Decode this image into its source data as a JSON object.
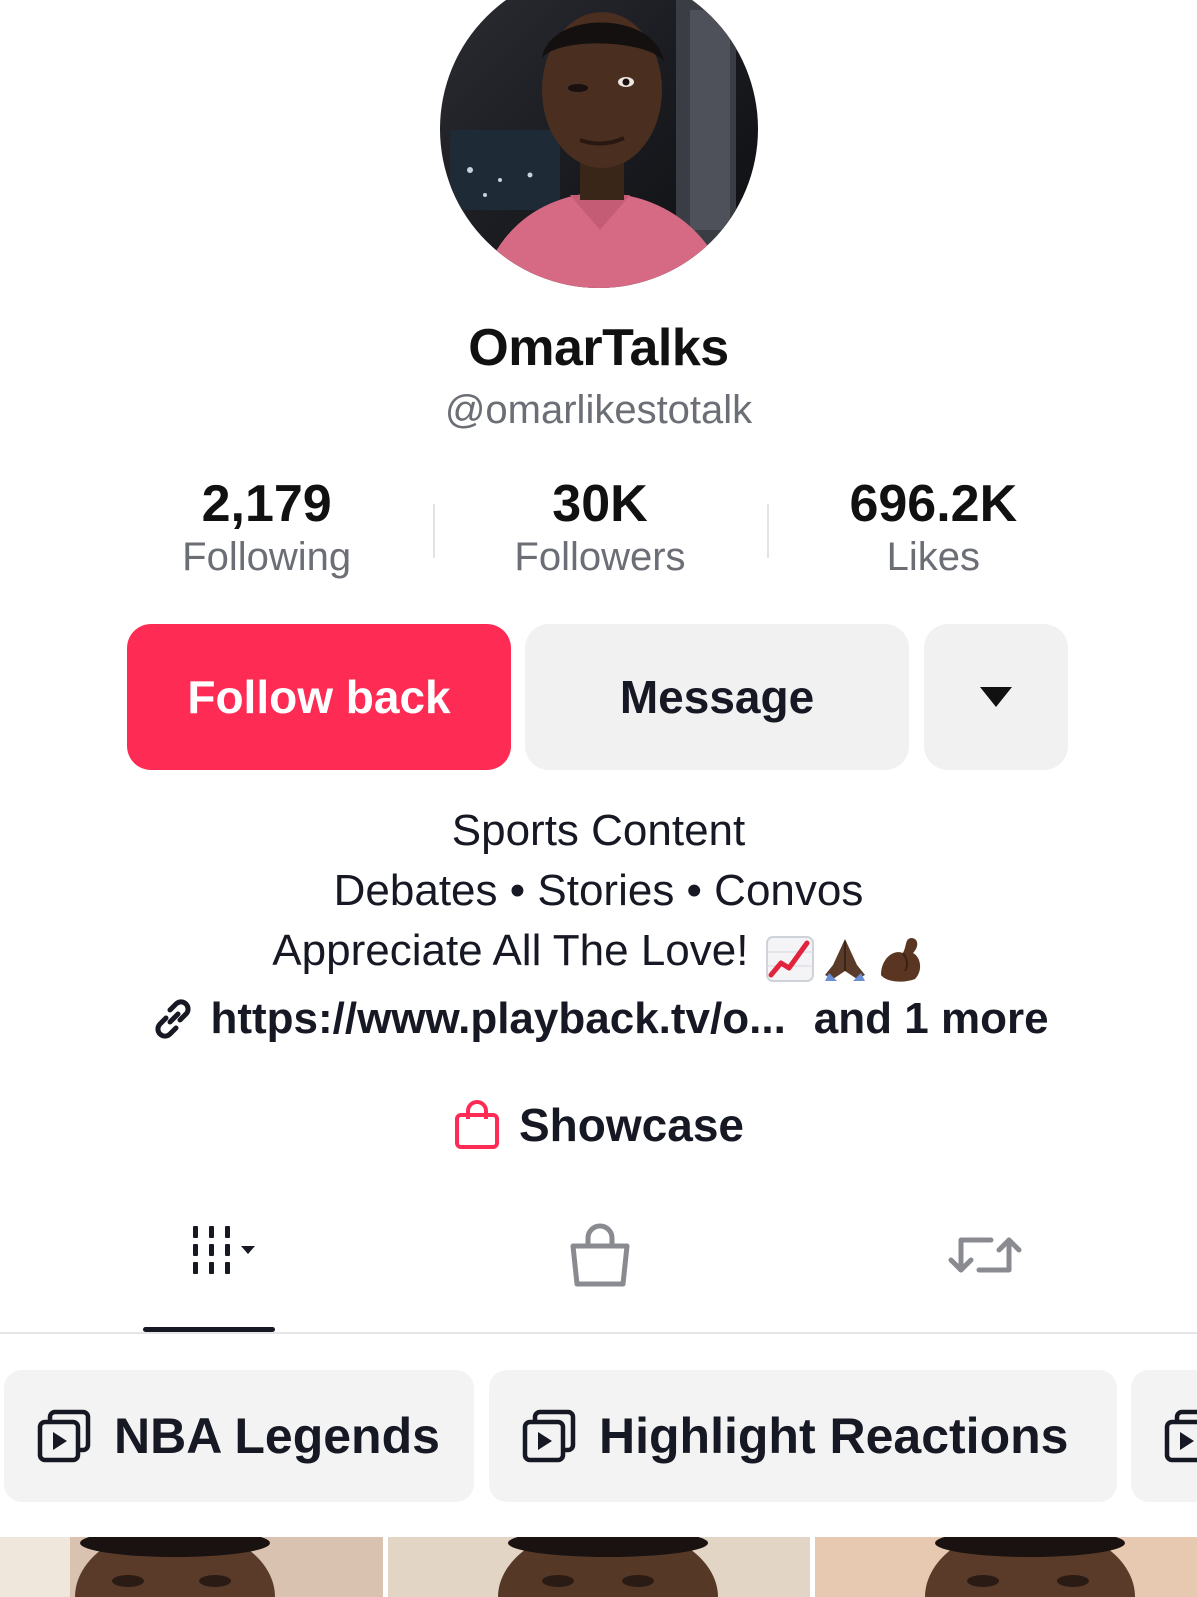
{
  "profile": {
    "display_name": "OmarTalks",
    "handle": "@omarlikestotalk",
    "avatar_icon": "avatar-photo"
  },
  "stats": [
    {
      "value": "2,179",
      "label": "Following"
    },
    {
      "value": "30K",
      "label": "Followers"
    },
    {
      "value": "696.2K",
      "label": "Likes"
    }
  ],
  "actions": {
    "follow_label": "Follow back",
    "message_label": "Message",
    "more_icon": "caret-down-icon"
  },
  "bio": {
    "line1": "Sports Content",
    "line2": "Debates • Stories • Convos",
    "line3": "Appreciate All The Love!",
    "line3_emojis": [
      "chart-increasing-icon",
      "folded-hands-icon",
      "flexed-biceps-icon"
    ],
    "link_text": "https://www.playback.tv/o...",
    "link_more": "and 1 more"
  },
  "showcase": {
    "label": "Showcase",
    "icon": "shopping-bag-icon"
  },
  "tabs": [
    {
      "name": "videos",
      "icon": "grid-icon",
      "active": true
    },
    {
      "name": "shop",
      "icon": "shopping-bag-icon",
      "active": false
    },
    {
      "name": "reposts",
      "icon": "repost-icon",
      "active": false
    }
  ],
  "playlists": [
    {
      "label": "NBA Legends",
      "icon": "playlist-icon"
    },
    {
      "label": "Highlight Reactions",
      "icon": "playlist-icon"
    },
    {
      "label": "",
      "icon": "playlist-icon"
    }
  ],
  "colors": {
    "accent": "#fe2c55",
    "button_gray": "#f1f1f2",
    "text_primary": "#161823",
    "text_secondary": "#6b6e75"
  }
}
